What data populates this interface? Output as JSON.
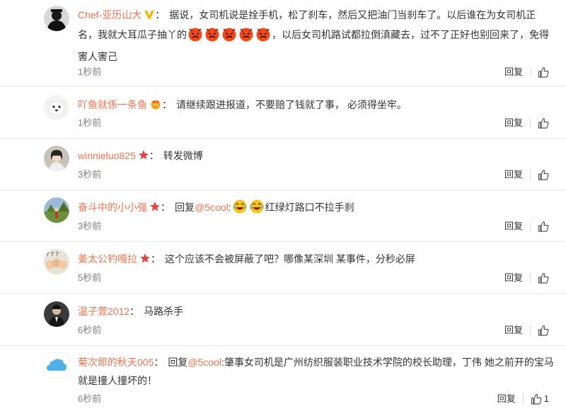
{
  "comments": [
    {
      "username": "Chef-亚历山大",
      "colon": "：",
      "text_a": "据说，女司机说是拴手机，松了刹车，然后又把油门当刹车了。以后谁在为女司机正名，我就大耳瓜子抽丫的",
      "text_b": "，以后女司机路试都拉倒滇藏去，过不了正好也别回来了，免得害人害己",
      "time": "1秒前",
      "reply": "回复",
      "likes": ""
    },
    {
      "username": "吖鱼就係一条鱼",
      "colon": "：",
      "text": "请继续跟进报道，不要赔了钱就了事， 必须得坐牢。",
      "time": "1秒前",
      "reply": "回复",
      "likes": ""
    },
    {
      "username": "winnieluo825",
      "colon": "：",
      "text": "转发微博",
      "time": "3秒前",
      "reply": "回复",
      "likes": ""
    },
    {
      "username": "奋斗中的小小强",
      "colon": "：",
      "reply_prefix": "回复",
      "mention": "@5cool",
      "colon2": ":",
      "text": "红绿灯路口不拉手刹",
      "time": "3秒前",
      "reply": "回复",
      "likes": ""
    },
    {
      "username": "姜太公钓嘎拉",
      "colon": "：",
      "text": "这个应该不会被屏蔽了吧？哪像某深圳 某事件，分秒必屏",
      "time": "5秒前",
      "reply": "回复",
      "likes": ""
    },
    {
      "username": "温子萱2012",
      "colon": "：",
      "text": "马路杀手",
      "time": "6秒前",
      "reply": "回复",
      "likes": ""
    },
    {
      "username": "菊次郎的秋天005",
      "colon": "：",
      "reply_prefix": "回复",
      "mention": "@5cool",
      "colon2": ":",
      "text": "肇事女司机是广州纺织服装职业技术学院的校长助理，丁伟 她之前开的宝马就是撞人撞坏的！",
      "time": "6秒前",
      "reply": "回复",
      "likes": "1"
    }
  ],
  "colors": {
    "username": "#eb7350",
    "text": "#333333",
    "time": "#808080",
    "divider": "#e9e9e9",
    "vip_badge": "#f7b500",
    "star_badge": "#e8413a"
  },
  "icons": {
    "vip": "vip-v-badge-icon",
    "star": "star-badge-icon",
    "like": "thumbs-up-icon",
    "angry": "angry-face-emoji-icon",
    "laugh": "laughing-face-emoji-icon",
    "crown": "crown-badge-icon"
  }
}
